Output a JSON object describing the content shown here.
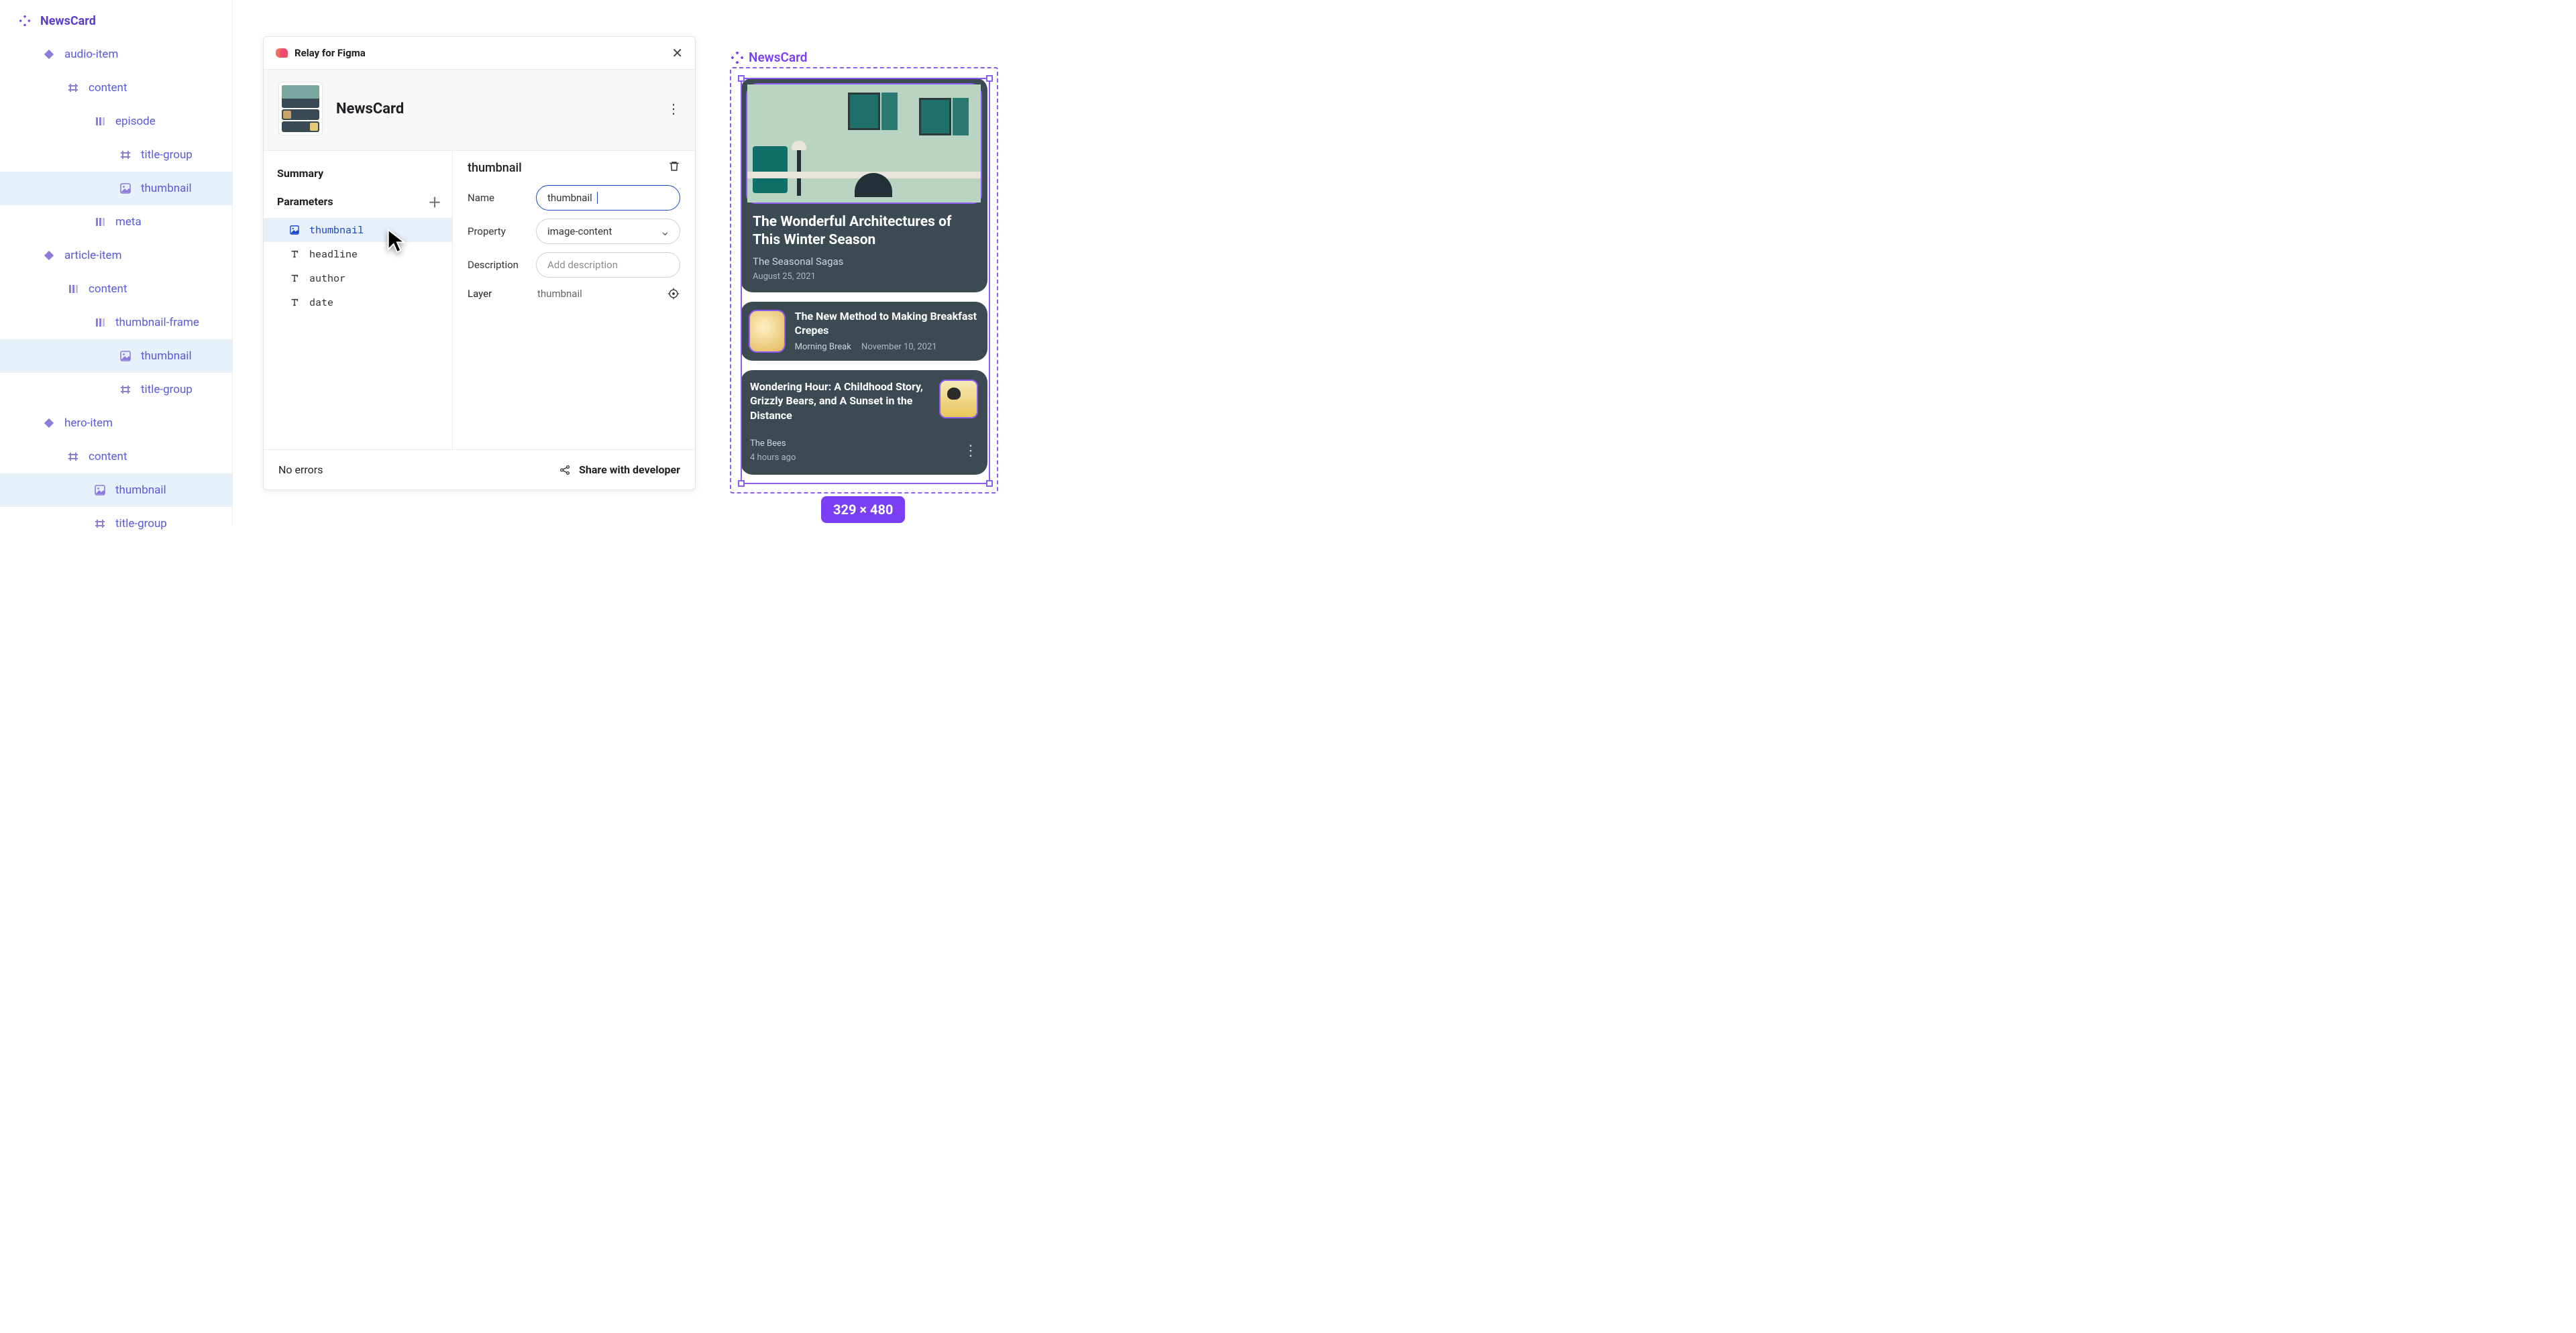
{
  "sidebar": {
    "root": "NewsCard",
    "items": [
      {
        "icon": "component",
        "label": "NewsCard",
        "indent": 0,
        "top": true
      },
      {
        "icon": "instance",
        "label": "audio-item",
        "indent": 1
      },
      {
        "icon": "frame",
        "label": "content",
        "indent": 2
      },
      {
        "icon": "autolayout",
        "label": "episode",
        "indent": 3
      },
      {
        "icon": "frame",
        "label": "title-group",
        "indent": 4
      },
      {
        "icon": "image",
        "label": "thumbnail",
        "indent": 4,
        "selected": true
      },
      {
        "icon": "autolayout",
        "label": "meta",
        "indent": 3
      },
      {
        "icon": "instance",
        "label": "article-item",
        "indent": 1
      },
      {
        "icon": "autolayout",
        "label": "content",
        "indent": 2
      },
      {
        "icon": "autolayout",
        "label": "thumbnail-frame",
        "indent": 3
      },
      {
        "icon": "image",
        "label": "thumbnail",
        "indent": 4,
        "selected": true
      },
      {
        "icon": "frame",
        "label": "title-group",
        "indent": 4
      },
      {
        "icon": "instance",
        "label": "hero-item",
        "indent": 1
      },
      {
        "icon": "frame",
        "label": "content",
        "indent": 2
      },
      {
        "icon": "image",
        "label": "thumbnail",
        "indent": 3,
        "selected": true
      },
      {
        "icon": "frame",
        "label": "title-group",
        "indent": 3
      }
    ]
  },
  "dialog": {
    "plugin_title": "Relay for Figma",
    "component_name": "NewsCard",
    "summary_label": "Summary",
    "parameters_label": "Parameters",
    "parameters": [
      {
        "icon": "image",
        "name": "thumbnail",
        "active": true
      },
      {
        "icon": "text",
        "name": "headline"
      },
      {
        "icon": "text",
        "name": "author"
      },
      {
        "icon": "text",
        "name": "date"
      }
    ],
    "detail": {
      "heading": "thumbnail",
      "name_label": "Name",
      "name_value": "thumbnail",
      "property_label": "Property",
      "property_value": "image-content",
      "description_label": "Description",
      "description_placeholder": "Add description",
      "layer_label": "Layer",
      "layer_value": "thumbnail"
    },
    "footer": {
      "status": "No errors",
      "share": "Share with developer"
    }
  },
  "canvas": {
    "label": "NewsCard",
    "hero": {
      "headline": "The Wonderful Architectures of This Winter Season",
      "source": "The Seasonal Sagas",
      "date": "August 25, 2021"
    },
    "row2": {
      "headline": "The New Method to Making Breakfast Crepes",
      "source": "Morning Break",
      "date": "November 10, 2021"
    },
    "row3": {
      "headline": "Wondering Hour: A Childhood Story, Grizzly Bears, and A Sunset in the Distance",
      "source": "The Bees",
      "date": "4 hours ago"
    },
    "dimensions": "329 × 480"
  }
}
